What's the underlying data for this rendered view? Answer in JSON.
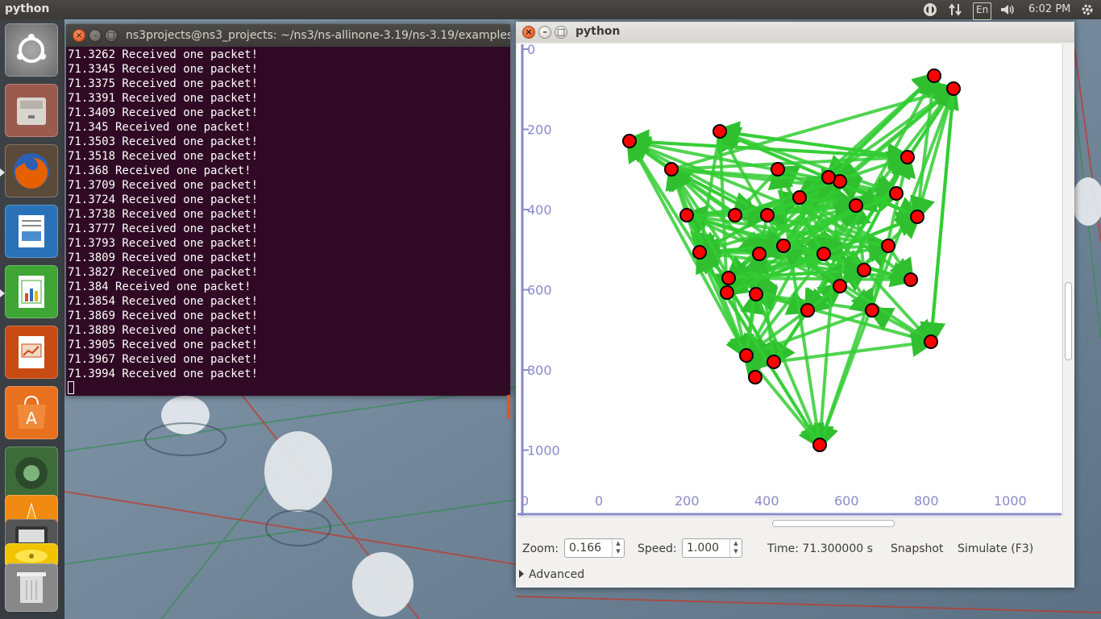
{
  "top_panel": {
    "app_title": "python",
    "language": "En",
    "clock": "6:02 PM",
    "icons": [
      "dropbox-icon",
      "network-icon",
      "keyboard-language-icon",
      "volume-icon",
      "settings-gear-icon"
    ]
  },
  "launcher": {
    "items": [
      {
        "name": "ubuntu-dash-icon",
        "color": "#7a7a7a"
      },
      {
        "name": "files-icon",
        "color": "#9a6a55"
      },
      {
        "name": "firefox-icon",
        "color": "#e66000"
      },
      {
        "name": "libreoffice-writer-icon",
        "color": "#2a72b8"
      },
      {
        "name": "libreoffice-calc-icon",
        "color": "#3fa535"
      },
      {
        "name": "libreoffice-impress-icon",
        "color": "#c74b12"
      },
      {
        "name": "software-center-icon",
        "color": "#e8701f"
      },
      {
        "name": "workspace-switcher-icon",
        "color": "#4b8f47"
      },
      {
        "name": "vlc-icon",
        "color": "#f08a10"
      },
      {
        "name": "system-settings-icon",
        "color": "#777777"
      },
      {
        "name": "trash-icon",
        "color": "#888888"
      }
    ]
  },
  "terminal": {
    "title": "ns3projects@ns3_projects: ~/ns3/ns-allinone-3.19/ns-3.19/examples",
    "lines": [
      "71.3262 Received one packet!",
      "71.3345 Received one packet!",
      "71.3375 Received one packet!",
      "71.3391 Received one packet!",
      "71.3409 Received one packet!",
      "71.345 Received one packet!",
      "71.3503 Received one packet!",
      "71.3518 Received one packet!",
      "71.368 Received one packet!",
      "71.3709 Received one packet!",
      "71.3724 Received one packet!",
      "71.3738 Received one packet!",
      "71.3777 Received one packet!",
      "71.3793 Received one packet!",
      "71.3809 Received one packet!",
      "71.3827 Received one packet!",
      "71.384 Received one packet!",
      "71.3854 Received one packet!",
      "71.3869 Received one packet!",
      "71.3889 Received one packet!",
      "71.3905 Received one packet!",
      "71.3967 Received one packet!",
      "71.3994 Received one packet!"
    ]
  },
  "visualizer": {
    "title": "python",
    "x_ticks": [
      "0",
      "0",
      "200",
      "400",
      "600",
      "800",
      "1000"
    ],
    "y_ticks": [
      "0",
      "200",
      "400",
      "600",
      "800",
      "1000"
    ],
    "axis_color": "#8a8acb",
    "node_color": "#ff0000",
    "link_color": "#33cc33",
    "nodes_approx_count": 40,
    "zoom_label": "Zoom:",
    "zoom_value": "0.166",
    "speed_label": "Speed:",
    "speed_value": "1.000",
    "time_text": "Time: 71.300000 s",
    "snapshot_label": "Snapshot",
    "simulate_label": "Simulate (F3)",
    "advanced_label": "Advanced"
  }
}
